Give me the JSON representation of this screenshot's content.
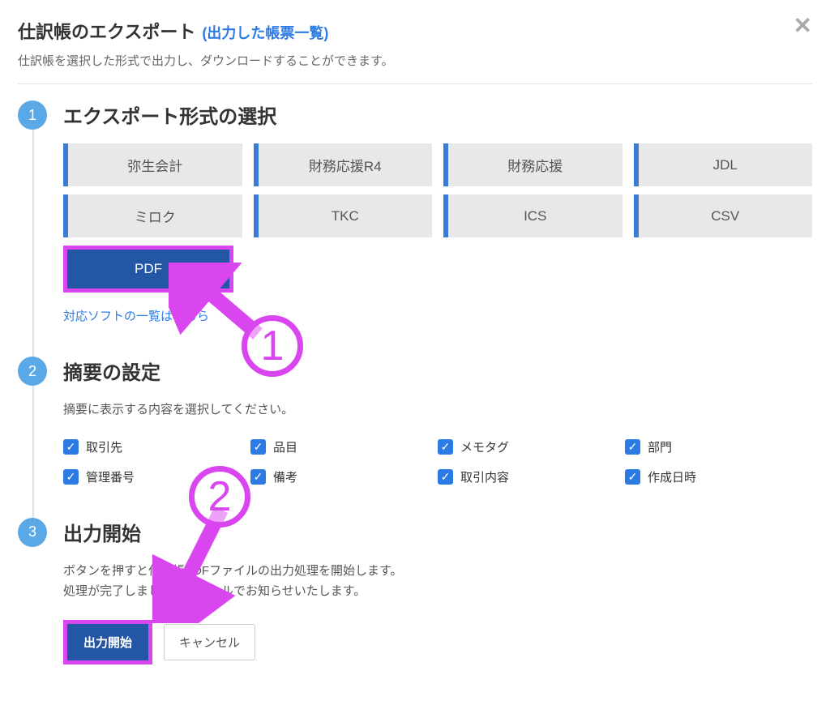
{
  "header": {
    "title": "仕訳帳のエクスポート",
    "link": "(出力した帳票一覧)",
    "subtitle": "仕訳帳を選択した形式で出力し、ダウンロードすることができます。"
  },
  "steps": {
    "s1": {
      "num": "1",
      "title": "エクスポート形式の選択",
      "formats": [
        "弥生会計",
        "財務応援R4",
        "財務応援",
        "JDL",
        "ミロク",
        "TKC",
        "ICS",
        "CSV"
      ],
      "pdf": "PDF",
      "help_link": "対応ソフトの一覧はこちら"
    },
    "s2": {
      "num": "2",
      "title": "摘要の設定",
      "desc": "摘要に表示する内容を選択してください。",
      "checkboxes": [
        "取引先",
        "品目",
        "メモタグ",
        "部門",
        "管理番号",
        "備考",
        "取引内容",
        "作成日時"
      ]
    },
    "s3": {
      "num": "3",
      "title": "出力開始",
      "desc_line1": "ボタンを押すと仕訳帳PDFファイルの出力処理を開始します。",
      "desc_line2": "処理が完了しましたら、メールでお知らせいたします。",
      "submit": "出力開始",
      "cancel": "キャンセル"
    }
  },
  "annotations": {
    "a1": "1",
    "a2": "2"
  }
}
